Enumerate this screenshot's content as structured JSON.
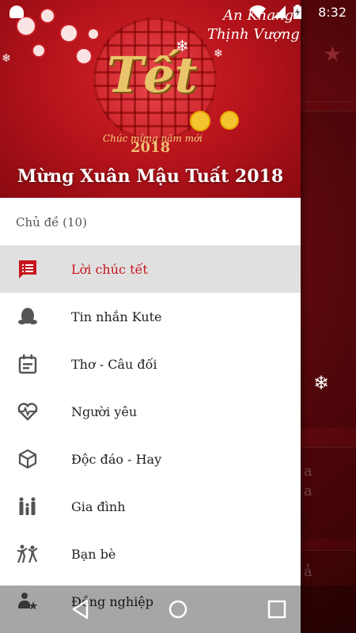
{
  "status_bar": {
    "time": "8:32"
  },
  "header": {
    "title": "Mừng Xuân Mậu Tuất 2018",
    "calligraphy_line1": "An Khang",
    "calligraphy_line2": "Thịnh Vượng",
    "logo_text": "Tết",
    "greeting": "Chúc mừng năm mới",
    "year": "2018"
  },
  "drawer": {
    "section_label": "Chủ đề (10)",
    "items": [
      {
        "label": "Lời chúc tết",
        "icon": "message-list-icon",
        "active": true
      },
      {
        "label": "Tin nhắn Kute",
        "icon": "qq-penguin-icon",
        "active": false
      },
      {
        "label": "Thơ - Câu đối",
        "icon": "calendar-note-icon",
        "active": false
      },
      {
        "label": "Người yêu",
        "icon": "heart-pulse-icon",
        "active": false
      },
      {
        "label": "Độc đáo - Hay",
        "icon": "cube-icon",
        "active": false
      },
      {
        "label": "Gia đình",
        "icon": "family-icon",
        "active": false
      },
      {
        "label": "Bạn bè",
        "icon": "friends-icon",
        "active": false
      },
      {
        "label": "Đồng nghiệp",
        "icon": "colleague-star-icon",
        "active": false
      }
    ]
  },
  "background": {
    "partial_text_1": "a",
    "partial_text_2": "a",
    "partial_text_3": "ả"
  },
  "colors": {
    "accent": "#c7161e",
    "header_red": "#b5131b",
    "active_bg": "#e0e0e0"
  }
}
